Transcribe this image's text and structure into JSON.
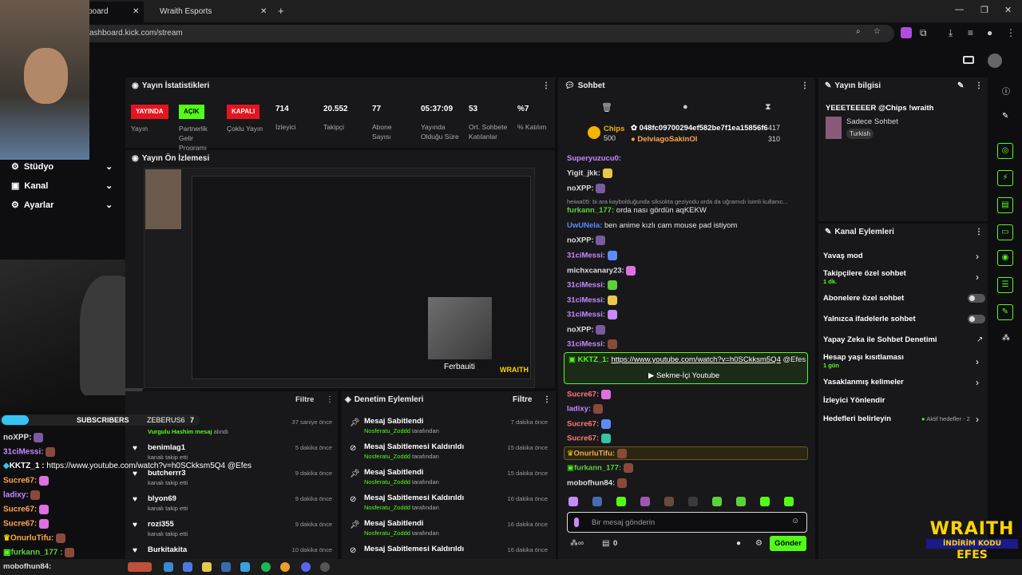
{
  "browser": {
    "tab1": "board",
    "tab2": "Wraith Esports",
    "url": "ashboard.kick.com/stream"
  },
  "sidebar": {
    "items": [
      {
        "label": "Stüdyo"
      },
      {
        "label": "Kanal"
      },
      {
        "label": "Ayarlar"
      }
    ]
  },
  "stats": {
    "title": "Yayın İstatistikleri",
    "badges": [
      "YAYINDA",
      "AÇIK",
      "KAPALI"
    ],
    "items": [
      {
        "value": "",
        "label": "Yayın"
      },
      {
        "value": "",
        "label": "Partnerlik Gelir Programı"
      },
      {
        "value": "",
        "label": "Çoklu Yayın"
      },
      {
        "value": "714",
        "label": "İzleyici"
      },
      {
        "value": "20.552",
        "label": "Takipçi"
      },
      {
        "value": "77",
        "label": "Abone Sayısı"
      },
      {
        "value": "05:37:09",
        "label": "Yayında Olduğu Süre"
      },
      {
        "value": "53",
        "label": "Ort. Sohbete Katılanlar"
      },
      {
        "value": "%7",
        "label": "% Katılım"
      }
    ]
  },
  "preview": {
    "title": "Yayın Ön İzlemesi",
    "overlay": "Ferbauiti",
    "brand": "WRAITH",
    "brand2": "İNDİRİM KODU",
    "brand3": "EFES"
  },
  "feed": {
    "filter": "Filtre",
    "subs_label": "SUBSCRIBERS",
    "subs_user": "ZEBERUS6",
    "subs_count": "7",
    "rows": [
      {
        "name": "Vurgulu Hashim mesaj",
        "sub": "alındı",
        "time": "37 saniye önce"
      },
      {
        "name": "benimlag1",
        "sub": "kanalı takip etti",
        "time": "5 dakika önce"
      },
      {
        "name": "butcherrr3",
        "sub": "kanalı takip etti",
        "time": "9 dakika önce"
      },
      {
        "name": "blyon69",
        "sub": "kanalı takip etti",
        "time": "9 dakika önce"
      },
      {
        "name": "rozi355",
        "sub": "kanalı takip etti",
        "time": "9 dakika önce"
      },
      {
        "name": "Burkitakita",
        "sub": "",
        "time": "10 dakika önce"
      }
    ]
  },
  "mod": {
    "title": "Denetim Eylemleri",
    "filter": "Filtre",
    "rows": [
      {
        "name": "Mesaj Sabitlendi",
        "by": "Nosferatu_Zoddd",
        "suffix": "tarafından",
        "time": "7 dakika önce"
      },
      {
        "name": "Mesaj Sabitlemesi Kaldırıldı",
        "by": "Nosferatu_Zoddd",
        "suffix": "tarafından",
        "time": "15 dakika önce"
      },
      {
        "name": "Mesaj Sabitlendi",
        "by": "Nosferatu_Zoddd",
        "suffix": "tarafından",
        "time": "15 dakika önce"
      },
      {
        "name": "Mesaj Sabitlemesi Kaldırıldı",
        "by": "Nosferatu_Zoddd",
        "suffix": "tarafından",
        "time": "16 dakika önce"
      },
      {
        "name": "Mesaj Sabitlendi",
        "by": "Nosferatu_Zoddd",
        "suffix": "tarafından",
        "time": "16 dakika önce"
      },
      {
        "name": "Mesaj Sabitlemesi Kaldırıldı",
        "by": "",
        "suffix": "",
        "time": "16 dakika önce"
      }
    ]
  },
  "chat": {
    "title": "Sohbet",
    "chips": {
      "label": "Chips",
      "value": "500",
      "id": "048fc09700294ef582be7f1ea15856f6",
      "id_count": "417",
      "user": "DelviagoSakinOl",
      "user_count": "310"
    },
    "messages": [
      {
        "user": "Superyuzucu0:",
        "text": "",
        "c": "u1"
      },
      {
        "user": "Yigit_jkk:",
        "text": "",
        "c": "u6"
      },
      {
        "user": "noXPP:",
        "text": "",
        "c": "u6"
      },
      {
        "user": "heiwa05:",
        "text": "bi ara kaybolduğunda siksokta geziyodu orda da uğramıdı isimli kullanıc...",
        "c": "u6"
      },
      {
        "user": "furkann_177:",
        "text": "orda nası gördün aqKEKW",
        "c": "u2"
      },
      {
        "user": "UwUNela:",
        "text": "ben anime kızlı cam mouse pad istiyom",
        "c": "u4"
      },
      {
        "user": "noXPP:",
        "text": "",
        "c": "u6"
      },
      {
        "user": "31ciMessi:",
        "text": "",
        "c": "u1"
      },
      {
        "user": "michxcanary23:",
        "text": "",
        "c": "u6"
      },
      {
        "user": "31ciMessi:",
        "text": "",
        "c": "u1"
      },
      {
        "user": "31ciMessi:",
        "text": "",
        "c": "u1"
      },
      {
        "user": "31ciMessi:",
        "text": "",
        "c": "u1"
      },
      {
        "user": "noXPP:",
        "text": "",
        "c": "u6"
      },
      {
        "user": "31ciMessi:",
        "text": "",
        "c": "u1"
      }
    ],
    "pinned": {
      "user": "KKTZ_1:",
      "link": "https://www.youtube.com/watch?v=h0SCkksm5Q4",
      "mention": "@Efes",
      "button": "Sekme-İçi Youtube"
    },
    "messages2": [
      {
        "user": "Sucre67:",
        "c": "u3"
      },
      {
        "user": "ladixy:",
        "c": "u1"
      },
      {
        "user": "Sucre67:",
        "c": "u3"
      },
      {
        "user": "Sucre67:",
        "c": "u3"
      },
      {
        "user": "OnurluTifu:",
        "c": "u5"
      },
      {
        "user": "furkann_177:",
        "c": "u2"
      },
      {
        "user": "mobofhun84:",
        "c": "u6"
      }
    ],
    "placeholder": "Bir mesaj gönderin",
    "count": "0",
    "send": "Gönder"
  },
  "info": {
    "title": "Yayın bilgisi",
    "stream_title": "YEEETEEEER @Chips !wraith",
    "mode": "Sadece Sohbet",
    "lang": "Turkish"
  },
  "actions": {
    "title": "Kanal Eylemleri",
    "items": [
      {
        "label": "Yavaş mod",
        "sub": ""
      },
      {
        "label": "Takipçilere özel sohbet",
        "sub": "1 dk."
      },
      {
        "label": "Abonelere özel sohbet",
        "sub": ""
      },
      {
        "label": "Yalnızca ifadelerle sohbet",
        "sub": ""
      },
      {
        "label": "Yapay Zeka ile Sohbet Denetimi",
        "sub": ""
      },
      {
        "label": "Hesap yaşı kısıtlaması",
        "sub": "1 gün"
      },
      {
        "label": "Yasaklanmış kelimeler",
        "sub": ""
      },
      {
        "label": "İzleyici Yönlendir",
        "sub": ""
      },
      {
        "label": "Hedefleri belirleyin",
        "sub": "Aktif hedefler - 2"
      }
    ]
  },
  "overlay_chat": [
    {
      "user": "noXPP:",
      "text": "",
      "c": "u6"
    },
    {
      "user": "31ciMessi:",
      "text": "",
      "c": "u1"
    },
    {
      "user": "KKTZ_1 :",
      "text": "https://www.youtube.com/watch?v=h0SCkksm5Q4 @Efes",
      "c": "u6"
    },
    {
      "user": "Sucre67:",
      "text": "",
      "c": "u5"
    },
    {
      "user": "ladixy:",
      "text": "",
      "c": "u1"
    },
    {
      "user": "Sucre67:",
      "text": "",
      "c": "u5"
    },
    {
      "user": "Sucre67:",
      "text": "",
      "c": "u5"
    },
    {
      "user": "OnurluTifu:",
      "text": "",
      "c": "u5"
    },
    {
      "user": "furkann_177 :",
      "text": "",
      "c": "u2"
    }
  ],
  "taskbar": {
    "user": "mobofhun84:"
  },
  "colors": {
    "accent": "#53fc18",
    "bg": "#0e0e10",
    "panel": "#18181b"
  }
}
